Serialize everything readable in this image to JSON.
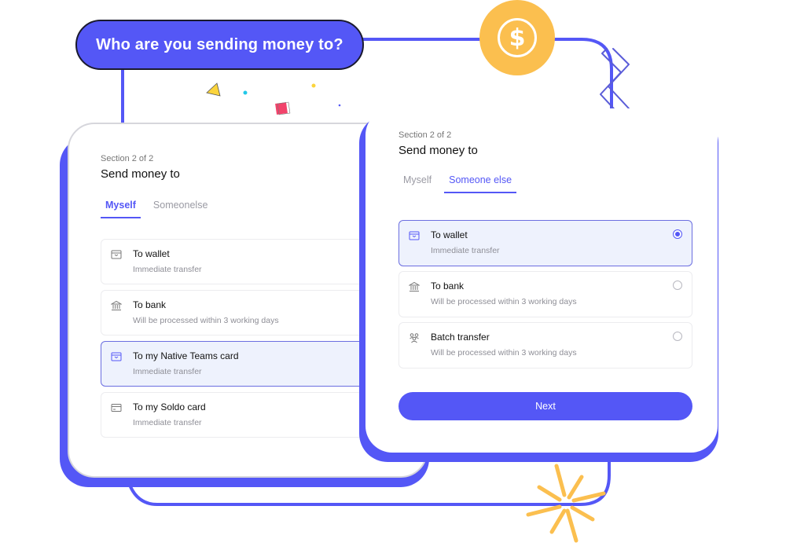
{
  "header": {
    "question": "Who are you sending money to?",
    "coin_icon": "dollar-coin-icon"
  },
  "colors": {
    "accent": "#5457f6",
    "coin": "#fbbf4f",
    "selected_bg": "#eef2fd"
  },
  "left_card": {
    "section": "Section 2 of 2",
    "title": "Send money to",
    "tabs": [
      {
        "label": "Myself",
        "active": true
      },
      {
        "label": "Someonelse",
        "active": false
      }
    ],
    "options": [
      {
        "icon": "wallet-icon",
        "title": "To wallet",
        "subtitle": "Immediate transfer",
        "selected": false
      },
      {
        "icon": "bank-icon",
        "title": "To bank",
        "subtitle": "Will be processed within 3 working days",
        "selected": false
      },
      {
        "icon": "wallet-icon",
        "title": "To my Native Teams card",
        "subtitle": "Immediate transfer",
        "selected": true
      },
      {
        "icon": "card-icon",
        "title": "To my Soldo card",
        "subtitle": "Immediate transfer",
        "selected": false
      }
    ]
  },
  "right_card": {
    "section": "Section 2 of 2",
    "title": "Send money to",
    "tabs": [
      {
        "label": "Myself",
        "active": false
      },
      {
        "label": "Someone else",
        "active": true
      }
    ],
    "options": [
      {
        "icon": "wallet-icon",
        "title": "To wallet",
        "subtitle": "Immediate transfer",
        "selected": true
      },
      {
        "icon": "bank-icon",
        "title": "To bank",
        "subtitle": "Will be processed within 3 working days",
        "selected": false
      },
      {
        "icon": "group-icon",
        "title": "Batch transfer",
        "subtitle": "Will be processed within 3 working days",
        "selected": false
      }
    ],
    "next_label": "Next"
  }
}
